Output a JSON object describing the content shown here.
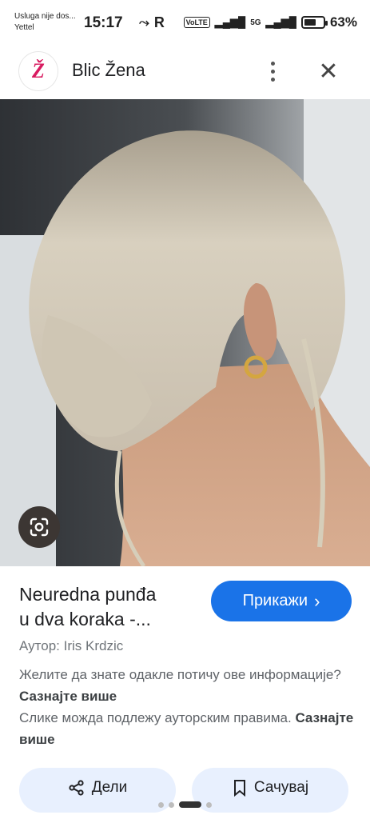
{
  "status_bar": {
    "carrier_line1": "Usluga nije dos...",
    "carrier_line2": "Yettel",
    "time": "15:17",
    "battery_level": "63%",
    "battery_fraction": 0.63,
    "network": "5G",
    "volte": "VoLTE"
  },
  "header": {
    "logo_letter": "Ž",
    "site_name": "Blic Žena",
    "more_icon": "more-vert-icon",
    "close_icon": "close-icon"
  },
  "result": {
    "title_line1": "Neuredna punđa",
    "title_line2": "u dva koraka -...",
    "visit_label": "Прикажи",
    "author": "Аутор: Iris Krdzic",
    "info_sentence1": "Желите да знате одакле потичу ове информације? ",
    "learn_more1": "Сазнајте више",
    "info_sentence2": "Слике можда подлежу ауторским правима. ",
    "learn_more2": "Сазнајте више"
  },
  "actions": {
    "share_label": "Дели",
    "save_label": "Сачувај"
  },
  "colors": {
    "accent": "#1a73e8",
    "logo": "#d81b60",
    "action_bg": "#e8f0fe"
  }
}
